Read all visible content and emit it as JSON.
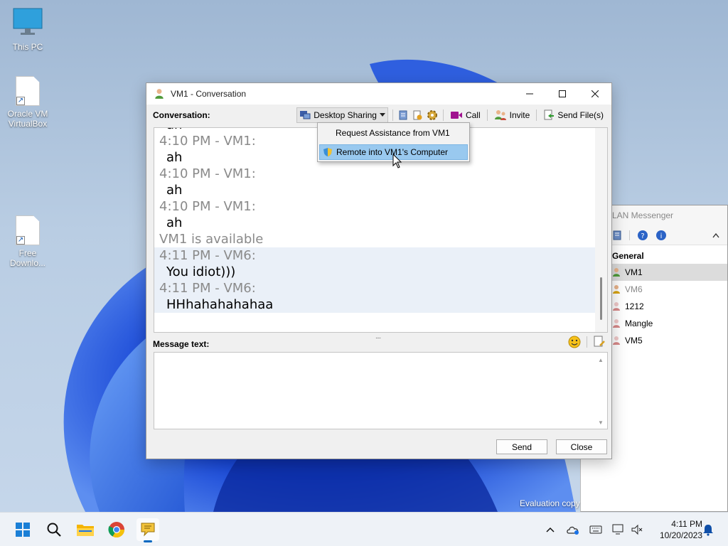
{
  "desktop": {
    "icons": [
      {
        "label": "This PC",
        "icon": "monitor-icon"
      },
      {
        "label": "Oracle VM VirtualBox",
        "icon": "file-shortcut-icon"
      },
      {
        "label": "Free Downlo...",
        "icon": "file-shortcut-icon"
      }
    ],
    "evaluation_text": "Evaluation copy"
  },
  "lan_messenger": {
    "title": "LAN Messenger",
    "group": "General",
    "users": [
      {
        "name": "VM1",
        "status": "online",
        "selected": true
      },
      {
        "name": "VM6",
        "status": "away",
        "selected": false
      },
      {
        "name": "1212",
        "status": "offline",
        "selected": false
      },
      {
        "name": "Mangle",
        "status": "offline",
        "selected": false
      },
      {
        "name": "VM5",
        "status": "offline",
        "selected": false
      }
    ]
  },
  "conversation": {
    "title": "VM1 - Conversation",
    "conversation_label": "Conversation:",
    "toolbar": {
      "desktop_sharing": "Desktop Sharing",
      "call": "Call",
      "invite": "Invite",
      "send_files": "Send File(s)"
    },
    "partial_text": "ah",
    "messages": [
      {
        "header": "4:10 PM - VM1:",
        "text": "ah",
        "highlight": false
      },
      {
        "header": "4:10 PM - VM1:",
        "text": "ah",
        "highlight": false
      },
      {
        "header": "4:10 PM - VM1:",
        "text": "ah",
        "highlight": false
      }
    ],
    "status_line": "VM1 is available",
    "messages_after": [
      {
        "header": "4:11 PM - VM6:",
        "text": "You idiot)))",
        "highlight": true
      },
      {
        "header": "4:11 PM - VM6:",
        "text": "HHhahahahahaa",
        "highlight": true
      }
    ],
    "splitter_glyph": "....",
    "message_label": "Message text:",
    "message_value": "",
    "send_label": "Send",
    "close_label": "Close"
  },
  "dropdown": {
    "items": [
      {
        "label": "Request Assistance from VM1"
      },
      {
        "label": "Remote into VM1's Computer"
      }
    ]
  },
  "taskbar": {
    "apps": [
      "start-icon",
      "search-icon",
      "file-explorer-icon",
      "chrome-icon",
      "lan-messenger-icon"
    ],
    "clock_time": "4:11 PM",
    "clock_date": "10/20/2023"
  },
  "colors": {
    "accent": "#0067c0",
    "menu_highlight": "#99c9ef",
    "message_highlight": "#eaf0f8",
    "header_gray": "#8a8a8a"
  }
}
